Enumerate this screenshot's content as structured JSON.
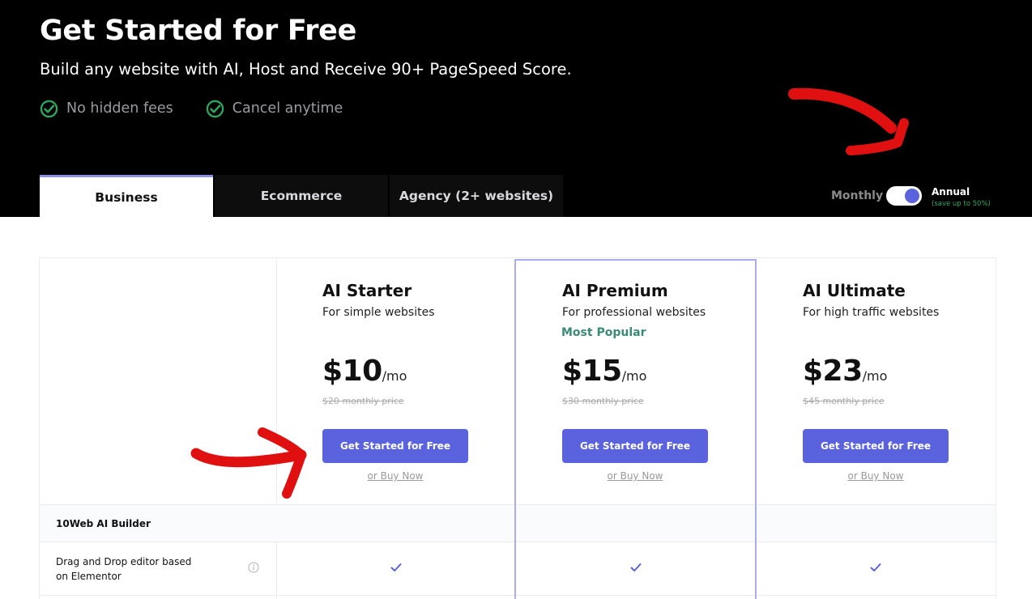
{
  "header": {
    "title": "Get Started for Free",
    "subtitle": "Build any website with AI, Host and Receive 90+ PageSpeed Score.",
    "features": [
      {
        "icon": "check-circle-icon",
        "label": "No hidden fees"
      },
      {
        "icon": "check-circle-icon",
        "label": "Cancel anytime"
      }
    ]
  },
  "tabs": [
    {
      "label": "Business",
      "active": true
    },
    {
      "label": "Ecommerce",
      "active": false
    },
    {
      "label": "Agency (2+ websites)",
      "active": false
    }
  ],
  "billing": {
    "monthly_label": "Monthly",
    "annual_label": "Annual",
    "annual_note": "(save up to 50%)",
    "annual_selected": true
  },
  "plans": [
    {
      "name": "AI Starter",
      "description": "For simple websites",
      "badge": "",
      "price": "$10",
      "period": "/mo",
      "original": "$20 monthly price",
      "cta": "Get Started for Free",
      "buy": "or Buy Now"
    },
    {
      "name": "AI Premium",
      "description": "For professional websites",
      "badge": "Most Popular",
      "price": "$15",
      "period": "/mo",
      "original": "$30 monthly price",
      "cta": "Get Started for Free",
      "buy": "or Buy Now"
    },
    {
      "name": "AI Ultimate",
      "description": "For high traffic websites",
      "badge": "",
      "price": "$23",
      "period": "/mo",
      "original": "$45 monthly price",
      "cta": "Get Started for Free",
      "buy": "or Buy Now"
    }
  ],
  "table": {
    "section": "10Web AI Builder",
    "rows": [
      {
        "label": "Drag and Drop editor based on Elementor",
        "starter": true,
        "premium": true,
        "ultimate": true
      }
    ]
  },
  "colors": {
    "accent": "#5a62dd",
    "highlight_border": "#a9acf2",
    "check_green": "#2ea860",
    "annotation_red": "#e01010"
  }
}
